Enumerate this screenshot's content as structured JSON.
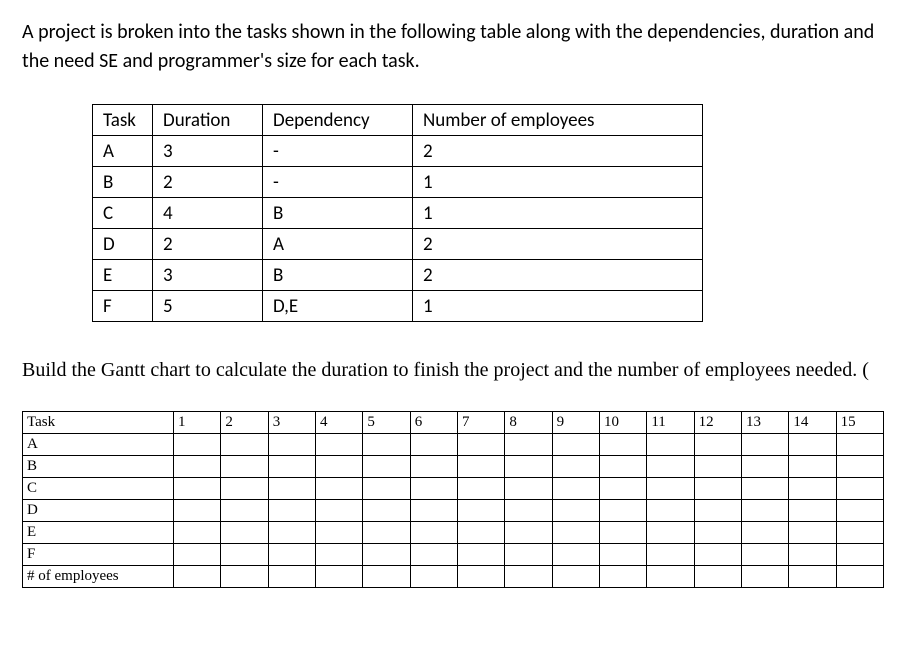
{
  "intro": "A project is broken into the tasks shown in the following table along with the dependencies, duration and the need SE and programmer's size for each task.",
  "task_table": {
    "headers": {
      "task": "Task",
      "duration": "Duration",
      "dependency": "Dependency",
      "employees": "Number of employees"
    },
    "rows": [
      {
        "task": "A",
        "duration": "3",
        "dependency": "-",
        "employees": "2"
      },
      {
        "task": "B",
        "duration": "2",
        "dependency": "-",
        "employees": "1"
      },
      {
        "task": "C",
        "duration": "4",
        "dependency": "B",
        "employees": "1"
      },
      {
        "task": "D",
        "duration": "2",
        "dependency": "A",
        "employees": "2"
      },
      {
        "task": "E",
        "duration": "3",
        "dependency": "B",
        "employees": "2"
      },
      {
        "task": "F",
        "duration": "5",
        "dependency": "D,E",
        "employees": "1"
      }
    ]
  },
  "instruction": "Build the Gantt chart to calculate the duration to finish the project and the number of employees needed. (",
  "gantt": {
    "header_label": "Task",
    "time_headers": [
      "1",
      "2",
      "3",
      "4",
      "5",
      "6",
      "7",
      "8",
      "9",
      "10",
      "11",
      "12",
      "13",
      "14",
      "15"
    ],
    "row_labels": [
      "A",
      "B",
      "C",
      "D",
      "E",
      "F",
      "# of employees"
    ]
  },
  "chart_data": {
    "type": "table",
    "title": "Gantt chart template",
    "columns": [
      "Task",
      "1",
      "2",
      "3",
      "4",
      "5",
      "6",
      "7",
      "8",
      "9",
      "10",
      "11",
      "12",
      "13",
      "14",
      "15"
    ],
    "rows": [
      [
        "A",
        "",
        "",
        "",
        "",
        "",
        "",
        "",
        "",
        "",
        "",
        "",
        "",
        "",
        "",
        ""
      ],
      [
        "B",
        "",
        "",
        "",
        "",
        "",
        "",
        "",
        "",
        "",
        "",
        "",
        "",
        "",
        "",
        ""
      ],
      [
        "C",
        "",
        "",
        "",
        "",
        "",
        "",
        "",
        "",
        "",
        "",
        "",
        "",
        "",
        "",
        ""
      ],
      [
        "D",
        "",
        "",
        "",
        "",
        "",
        "",
        "",
        "",
        "",
        "",
        "",
        "",
        "",
        "",
        ""
      ],
      [
        "E",
        "",
        "",
        "",
        "",
        "",
        "",
        "",
        "",
        "",
        "",
        "",
        "",
        "",
        "",
        ""
      ],
      [
        "F",
        "",
        "",
        "",
        "",
        "",
        "",
        "",
        "",
        "",
        "",
        "",
        "",
        "",
        "",
        ""
      ],
      [
        "# of employees",
        "",
        "",
        "",
        "",
        "",
        "",
        "",
        "",
        "",
        "",
        "",
        "",
        "",
        "",
        ""
      ]
    ]
  }
}
